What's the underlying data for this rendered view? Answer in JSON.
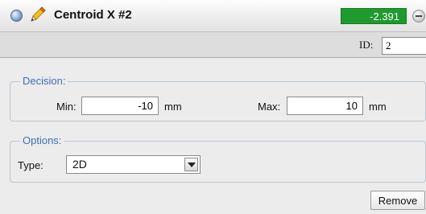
{
  "header": {
    "title": "Centroid X #2",
    "value": "-2.391",
    "value_color": "#1f9a2e"
  },
  "id_row": {
    "label": "ID:",
    "value": "2"
  },
  "decision": {
    "legend": "Decision:",
    "min_label": "Min:",
    "min_value": "-10",
    "min_unit": "mm",
    "max_label": "Max:",
    "max_value": "10",
    "max_unit": "mm"
  },
  "options": {
    "legend": "Options:",
    "type_label": "Type:",
    "type_selected": "2D"
  },
  "actions": {
    "remove_label": "Remove"
  },
  "icons": [
    "status-dot-icon",
    "pencil-icon",
    "minus-circle-icon",
    "chevron-down-icon"
  ]
}
